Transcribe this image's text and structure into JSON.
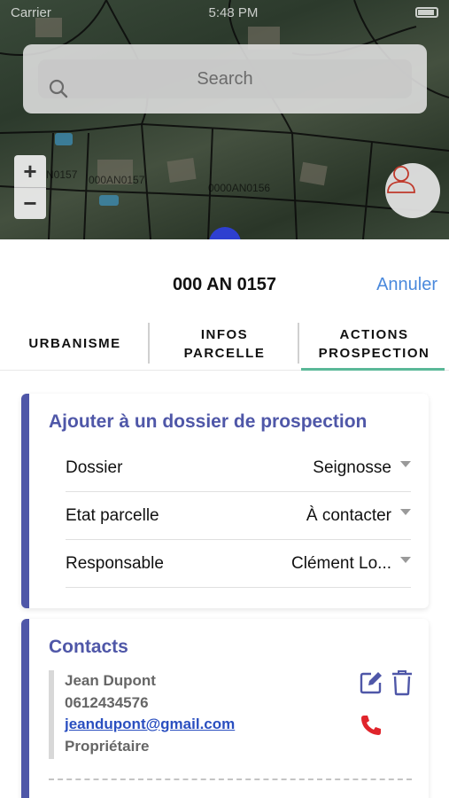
{
  "status_bar": {
    "carrier": "Carrier",
    "time": "5:48 PM"
  },
  "map": {
    "search_placeholder": "Search",
    "zoom_in_label": "+",
    "zoom_out_label": "−",
    "parcel_labels": [
      "N0157",
      "000AN0157",
      "0000AN0156"
    ]
  },
  "sheet": {
    "title": "000 AN 0157",
    "cancel_label": "Annuler"
  },
  "tabs": [
    {
      "line1": "URBANISME",
      "line2": ""
    },
    {
      "line1": "INFOS",
      "line2": "PARCELLE"
    },
    {
      "line1": "ACTIONS",
      "line2": "PROSPECTION"
    }
  ],
  "prospection": {
    "title": "Ajouter à un dossier de prospection",
    "rows": [
      {
        "label": "Dossier",
        "value": "Seignosse"
      },
      {
        "label": "Etat parcelle",
        "value": "À contacter"
      },
      {
        "label": "Responsable",
        "value": "Clément Lo..."
      }
    ]
  },
  "contacts": {
    "title": "Contacts",
    "items": [
      {
        "name": "Jean Dupont",
        "phone": "0612434576",
        "email": "jeandupont@gmail.com",
        "role": "Propriétaire"
      }
    ]
  },
  "colors": {
    "accent": "#4f57a8",
    "link": "#4a89dc",
    "tab_underline": "#5ab898",
    "phone": "#e0242b"
  },
  "icons": [
    "search-icon",
    "user-icon",
    "edit-icon",
    "trash-icon",
    "phone-icon"
  ]
}
